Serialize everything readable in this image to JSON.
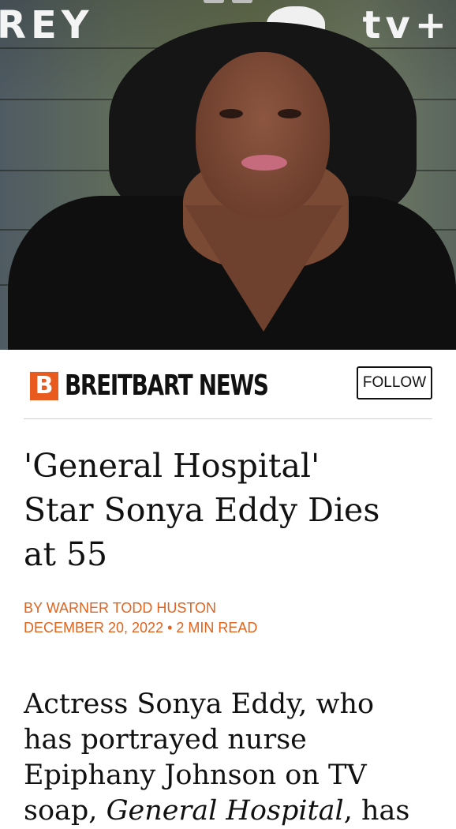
{
  "hero": {
    "banner_left": "REY",
    "banner_right": "tv+"
  },
  "publisher": {
    "logo_letter": "B",
    "name": "BREITBART NEWS",
    "follow_label": "FOLLOW",
    "brand_color": "#e85a1d"
  },
  "article": {
    "headline_line1": "'General Hospital'",
    "headline_line2": "Star Sonya Eddy Dies",
    "headline_line3": "at 55",
    "byline": "BY WARNER TODD HUSTON",
    "date_read": "DECEMBER 20, 2022 • 2 MIN READ",
    "accent_color": "#e0631e",
    "body_line1": "Actress Sonya Eddy, who",
    "body_line2": "has portrayed nurse",
    "body_line3": "Epiphany Johnson on TV",
    "body_line4_pre": "soap, ",
    "body_line4_em": "General Hospital",
    "body_line4_post": ", has"
  }
}
